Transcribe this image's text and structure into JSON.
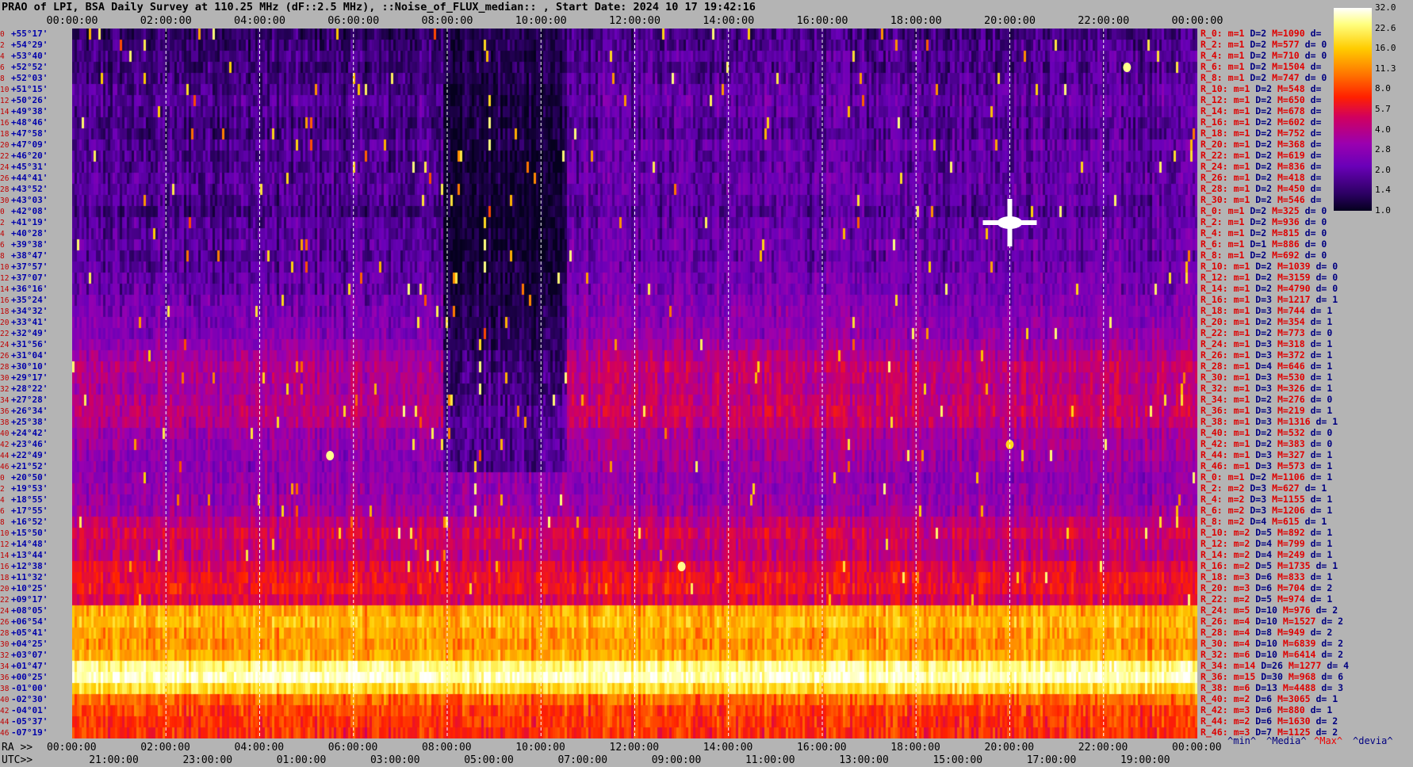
{
  "header": {
    "title": "PRAO of LPI, BSA Daily Survey at 110.25 MHz (dF::2.5 MHz), ::Noise_of_FLUX_median:: , Start Date: 2024 10 17 19:42:16"
  },
  "chart_data": {
    "type": "heatmap",
    "title": "PRAO of LPI, BSA Daily Survey at 110.25 MHz (dF::2.5 MHz), ::Noise_of_FLUX_median:: , Start Date: 2024 10 17 19:42:16",
    "x_top_ticks": [
      "00:00:00",
      "02:00:00",
      "04:00:00",
      "06:00:00",
      "08:00:00",
      "10:00:00",
      "12:00:00",
      "14:00:00",
      "16:00:00",
      "18:00:00",
      "20:00:00",
      "22:00:00",
      "00:00:00"
    ],
    "x_bottom_ra_label": "RA >>",
    "x_bottom_ra_ticks": [
      "00:00:00",
      "02:00:00",
      "04:00:00",
      "06:00:00",
      "08:00:00",
      "10:00:00",
      "12:00:00",
      "14:00:00",
      "16:00:00",
      "18:00:00",
      "20:00:00",
      "22:00:00",
      "00:00:00"
    ],
    "x_bottom_utc_label": "UTC>>",
    "x_bottom_utc_ticks": [
      "21:00:00",
      "23:00:00",
      "01:00:00",
      "03:00:00",
      "05:00:00",
      "07:00:00",
      "09:00:00",
      "11:00:00",
      "13:00:00",
      "15:00:00",
      "17:00:00",
      "19:00:00"
    ],
    "y_ticks": [
      "+55°17'",
      "+54°29'",
      "+53°40'",
      "+52°52'",
      "+52°03'",
      "+51°15'",
      "+50°26'",
      "+49°38'",
      "+48°46'",
      "+47°58'",
      "+47°09'",
      "+46°20'",
      "+45°31'",
      "+44°41'",
      "+43°52'",
      "+43°03'",
      "+42°08'",
      "+41°19'",
      "+40°28'",
      "+39°38'",
      "+38°47'",
      "+37°57'",
      "+37°07'",
      "+36°16'",
      "+35°24'",
      "+34°32'",
      "+33°41'",
      "+32°49'",
      "+31°56'",
      "+31°04'",
      "+30°10'",
      "+29°17'",
      "+28°22'",
      "+27°28'",
      "+26°34'",
      "+25°38'",
      "+24°42'",
      "+23°46'",
      "+22°49'",
      "+21°52'",
      "+20°50'",
      "+19°53'",
      "+18°55'",
      "+17°55'",
      "+16°52'",
      "+15°50'",
      "+14°48'",
      "+13°44'",
      "+12°38'",
      "+11°32'",
      "+10°25'",
      "+09°17'",
      "+08°05'",
      "+06°54'",
      "+05°41'",
      "+04°25'",
      "+03°07'",
      "+01°47'",
      "+00°25'",
      "-01°00'",
      "-02°30'",
      "-04°01'",
      "-05°37'",
      "-07°19'"
    ],
    "row_indices": [
      "0",
      "2",
      "4",
      "6",
      "8",
      "10",
      "12",
      "14",
      "16",
      "18",
      "20",
      "22",
      "24",
      "26",
      "28",
      "30",
      "0",
      "2",
      "4",
      "6",
      "8",
      "10",
      "12",
      "14",
      "16",
      "18",
      "20",
      "22",
      "24",
      "26",
      "28",
      "30",
      "32",
      "34",
      "36",
      "38",
      "40",
      "42",
      "44",
      "46",
      "0",
      "2",
      "4",
      "6",
      "8",
      "10",
      "12",
      "14",
      "16",
      "18",
      "20",
      "22",
      "24",
      "26",
      "28",
      "30",
      "32",
      "34",
      "36",
      "38",
      "40",
      "42",
      "44",
      "46"
    ],
    "colorbar": {
      "ticks": [
        "32.0",
        "22.6",
        "16.0",
        "11.3",
        "8.0",
        "5.7",
        "4.0",
        "2.8",
        "2.0",
        "1.4",
        "1.0"
      ],
      "scale": "log2",
      "range": [
        1.0,
        32.0
      ],
      "colors": [
        "#05001e",
        "#2a0060",
        "#6a00b8",
        "#9a00b0",
        "#d00060",
        "#ff2000",
        "#ff7a00",
        "#ffcc00",
        "#ffff80",
        "#ffffff"
      ]
    },
    "row_levels": [
      1.4,
      1.5,
      1.6,
      1.5,
      1.6,
      1.7,
      1.8,
      1.7,
      1.6,
      1.6,
      1.8,
      1.7,
      1.7,
      1.8,
      1.8,
      1.7,
      1.6,
      1.8,
      1.8,
      1.9,
      1.8,
      1.9,
      2.0,
      2.0,
      2.2,
      2.3,
      2.4,
      2.5,
      2.8,
      3.2,
      3.6,
      3.5,
      3.4,
      3.6,
      3.8,
      3.6,
      3.0,
      2.9,
      2.8,
      2.7,
      2.8,
      2.9,
      3.0,
      3.2,
      4.0,
      4.6,
      4.2,
      4.0,
      5.0,
      5.6,
      5.8,
      4.8,
      12.0,
      13.0,
      11.5,
      11.0,
      12.0,
      22.0,
      26.0,
      16.0,
      9.0,
      7.5,
      7.0,
      6.8
    ],
    "dark_region_levels": [
      1.3,
      1.3,
      1.2,
      1.3,
      1.3,
      1.2,
      1.2,
      1.2,
      1.2,
      1.2,
      1.2,
      1.1,
      1.1,
      1.1,
      1.1,
      1.1,
      1.1,
      1.1,
      1.1,
      1.1,
      1.1,
      1.2,
      1.2,
      1.2,
      1.2,
      1.3,
      1.3,
      1.4,
      1.4,
      1.5,
      1.6,
      1.6,
      1.6,
      1.7,
      1.8,
      1.8,
      1.8,
      1.8,
      1.8,
      1.8
    ],
    "bright_sources": [
      {
        "ra": "20:00:00",
        "dec": "+41°19'",
        "value": 32.0
      },
      {
        "ra": "22:30:00",
        "dec": "+52°52'",
        "value": 22.6
      },
      {
        "ra": "05:30:00",
        "dec": "+22°49'",
        "value": 22.6
      },
      {
        "ra": "20:00:00",
        "dec": "+23°46'",
        "value": 16.0
      },
      {
        "ra": "13:00:00",
        "dec": "+12°38'",
        "value": 22.6
      }
    ]
  },
  "stats": [
    {
      "r": "R_0:",
      "m": "m=1",
      "d": "D=2",
      "max": "M=1090",
      "dev": "d="
    },
    {
      "r": "R_2:",
      "m": "m=1",
      "d": "D=2",
      "max": "M=577",
      "dev": "d= 0"
    },
    {
      "r": "R_4:",
      "m": "m=1",
      "d": "D=2",
      "max": "M=710",
      "dev": "d= 0"
    },
    {
      "r": "R_6:",
      "m": "m=1",
      "d": "D=2",
      "max": "M=1504",
      "dev": "d="
    },
    {
      "r": "R_8:",
      "m": "m=1",
      "d": "D=2",
      "max": "M=747",
      "dev": "d= 0"
    },
    {
      "r": "R_10:",
      "m": "m=1",
      "d": "D=2",
      "max": "M=548",
      "dev": "d="
    },
    {
      "r": "R_12:",
      "m": "m=1",
      "d": "D=2",
      "max": "M=650",
      "dev": "d="
    },
    {
      "r": "R_14:",
      "m": "m=1",
      "d": "D=2",
      "max": "M=678",
      "dev": "d="
    },
    {
      "r": "R_16:",
      "m": "m=1",
      "d": "D=2",
      "max": "M=602",
      "dev": "d="
    },
    {
      "r": "R_18:",
      "m": "m=1",
      "d": "D=2",
      "max": "M=752",
      "dev": "d="
    },
    {
      "r": "R_20:",
      "m": "m=1",
      "d": "D=2",
      "max": "M=368",
      "dev": "d="
    },
    {
      "r": "R_22:",
      "m": "m=1",
      "d": "D=2",
      "max": "M=619",
      "dev": "d="
    },
    {
      "r": "R_24:",
      "m": "m=1",
      "d": "D=2",
      "max": "M=836",
      "dev": "d="
    },
    {
      "r": "R_26:",
      "m": "m=1",
      "d": "D=2",
      "max": "M=418",
      "dev": "d="
    },
    {
      "r": "R_28:",
      "m": "m=1",
      "d": "D=2",
      "max": "M=450",
      "dev": "d="
    },
    {
      "r": "R_30:",
      "m": "m=1",
      "d": "D=2",
      "max": "M=546",
      "dev": "d="
    },
    {
      "r": "R_0:",
      "m": "m=1",
      "d": "D=2",
      "max": "M=325",
      "dev": "d= 0"
    },
    {
      "r": "R_2:",
      "m": "m=1",
      "d": "D=2",
      "max": "M=936",
      "dev": "d= 0"
    },
    {
      "r": "R_4:",
      "m": "m=1",
      "d": "D=2",
      "max": "M=815",
      "dev": "d= 0"
    },
    {
      "r": "R_6:",
      "m": "m=1",
      "d": "D=1",
      "max": "M=886",
      "dev": "d= 0"
    },
    {
      "r": "R_8:",
      "m": "m=1",
      "d": "D=2",
      "max": "M=692",
      "dev": "d= 0"
    },
    {
      "r": "R_10:",
      "m": "m=1",
      "d": "D=2",
      "max": "M=1039",
      "dev": "d= 0"
    },
    {
      "r": "R_12:",
      "m": "m=1",
      "d": "D=2",
      "max": "M=3159",
      "dev": "d= 0"
    },
    {
      "r": "R_14:",
      "m": "m=1",
      "d": "D=2",
      "max": "M=4790",
      "dev": "d= 0"
    },
    {
      "r": "R_16:",
      "m": "m=1",
      "d": "D=3",
      "max": "M=1217",
      "dev": "d= 1"
    },
    {
      "r": "R_18:",
      "m": "m=1",
      "d": "D=3",
      "max": "M=744",
      "dev": "d= 1"
    },
    {
      "r": "R_20:",
      "m": "m=1",
      "d": "D=2",
      "max": "M=354",
      "dev": "d= 1"
    },
    {
      "r": "R_22:",
      "m": "m=1",
      "d": "D=2",
      "max": "M=773",
      "dev": "d= 0"
    },
    {
      "r": "R_24:",
      "m": "m=1",
      "d": "D=3",
      "max": "M=318",
      "dev": "d= 1"
    },
    {
      "r": "R_26:",
      "m": "m=1",
      "d": "D=3",
      "max": "M=372",
      "dev": "d= 1"
    },
    {
      "r": "R_28:",
      "m": "m=1",
      "d": "D=4",
      "max": "M=646",
      "dev": "d= 1"
    },
    {
      "r": "R_30:",
      "m": "m=1",
      "d": "D=3",
      "max": "M=530",
      "dev": "d= 1"
    },
    {
      "r": "R_32:",
      "m": "m=1",
      "d": "D=3",
      "max": "M=326",
      "dev": "d= 1"
    },
    {
      "r": "R_34:",
      "m": "m=1",
      "d": "D=2",
      "max": "M=276",
      "dev": "d= 0"
    },
    {
      "r": "R_36:",
      "m": "m=1",
      "d": "D=3",
      "max": "M=219",
      "dev": "d= 1"
    },
    {
      "r": "R_38:",
      "m": "m=1",
      "d": "D=3",
      "max": "M=1316",
      "dev": "d= 1"
    },
    {
      "r": "R_40:",
      "m": "m=1",
      "d": "D=2",
      "max": "M=532",
      "dev": "d= 0"
    },
    {
      "r": "R_42:",
      "m": "m=1",
      "d": "D=2",
      "max": "M=383",
      "dev": "d= 0"
    },
    {
      "r": "R_44:",
      "m": "m=1",
      "d": "D=3",
      "max": "M=327",
      "dev": "d= 1"
    },
    {
      "r": "R_46:",
      "m": "m=1",
      "d": "D=3",
      "max": "M=573",
      "dev": "d= 1"
    },
    {
      "r": "R_0:",
      "m": "m=1",
      "d": "D=2",
      "max": "M=1106",
      "dev": "d= 1"
    },
    {
      "r": "R_2:",
      "m": "m=2",
      "d": "D=3",
      "max": "M=627",
      "dev": "d= 1"
    },
    {
      "r": "R_4:",
      "m": "m=2",
      "d": "D=3",
      "max": "M=1155",
      "dev": "d= 1"
    },
    {
      "r": "R_6:",
      "m": "m=2",
      "d": "D=3",
      "max": "M=1206",
      "dev": "d= 1"
    },
    {
      "r": "R_8:",
      "m": "m=2",
      "d": "D=4",
      "max": "M=615",
      "dev": "d= 1"
    },
    {
      "r": "R_10:",
      "m": "m=2",
      "d": "D=5",
      "max": "M=892",
      "dev": "d= 1"
    },
    {
      "r": "R_12:",
      "m": "m=2",
      "d": "D=4",
      "max": "M=799",
      "dev": "d= 1"
    },
    {
      "r": "R_14:",
      "m": "m=2",
      "d": "D=4",
      "max": "M=249",
      "dev": "d= 1"
    },
    {
      "r": "R_16:",
      "m": "m=2",
      "d": "D=5",
      "max": "M=1735",
      "dev": "d= 1"
    },
    {
      "r": "R_18:",
      "m": "m=3",
      "d": "D=6",
      "max": "M=833",
      "dev": "d= 1"
    },
    {
      "r": "R_20:",
      "m": "m=3",
      "d": "D=6",
      "max": "M=704",
      "dev": "d= 2"
    },
    {
      "r": "R_22:",
      "m": "m=2",
      "d": "D=5",
      "max": "M=974",
      "dev": "d= 1"
    },
    {
      "r": "R_24:",
      "m": "m=5",
      "d": "D=10",
      "max": "M=976",
      "dev": "d= 2"
    },
    {
      "r": "R_26:",
      "m": "m=4",
      "d": "D=10",
      "max": "M=1527",
      "dev": "d= 2"
    },
    {
      "r": "R_28:",
      "m": "m=4",
      "d": "D=8",
      "max": "M=949",
      "dev": "d= 2"
    },
    {
      "r": "R_30:",
      "m": "m=4",
      "d": "D=10",
      "max": "M=6839",
      "dev": "d= 2"
    },
    {
      "r": "R_32:",
      "m": "m=6",
      "d": "D=10",
      "max": "M=6414",
      "dev": "d= 2"
    },
    {
      "r": "R_34:",
      "m": "m=14",
      "d": "D=26",
      "max": "M=1277",
      "dev": "d= 4"
    },
    {
      "r": "R_36:",
      "m": "m=15",
      "d": "D=30",
      "max": "M=968",
      "dev": "d= 6"
    },
    {
      "r": "R_38:",
      "m": "m=6",
      "d": "D=13",
      "max": "M=4488",
      "dev": "d= 3"
    },
    {
      "r": "R_40:",
      "m": "m=2",
      "d": "D=6",
      "max": "M=3065",
      "dev": "d= 1"
    },
    {
      "r": "R_42:",
      "m": "m=3",
      "d": "D=6",
      "max": "M=880",
      "dev": "d= 1"
    },
    {
      "r": "R_44:",
      "m": "m=2",
      "d": "D=6",
      "max": "M=1630",
      "dev": "d= 2"
    },
    {
      "r": "R_46:",
      "m": "m=3",
      "d": "D=7",
      "max": "M=1125",
      "dev": "d= 2"
    }
  ],
  "legend": {
    "min": "^min^",
    "median": "^Media^",
    "max": "^Max^",
    "devia": "^devia^"
  },
  "colors": {
    "legend_min": "#000080",
    "legend_median": "#000080",
    "legend_max": "#ee0000",
    "legend_devia": "#000080"
  }
}
